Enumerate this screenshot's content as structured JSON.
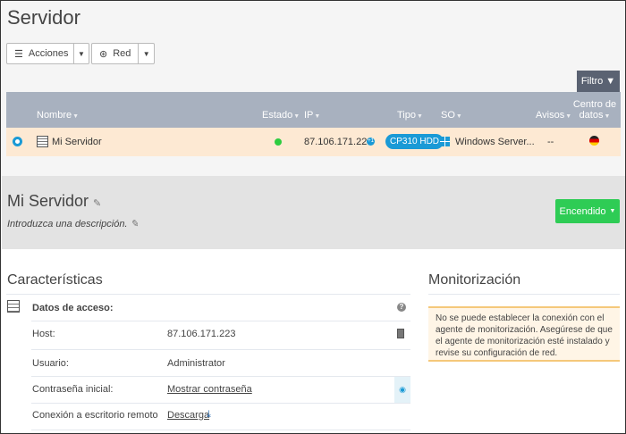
{
  "page_title": "Servidor",
  "toolbar": {
    "actions_label": "Acciones",
    "network_label": "Red",
    "filter_label": "Filtro"
  },
  "table": {
    "headers": {
      "name": "Nombre",
      "status": "Estado",
      "ip": "IP",
      "type": "Tipo",
      "os": "SO",
      "alerts": "Avisos",
      "datacenter": "Centro de datos"
    },
    "rows": [
      {
        "name": "Mi Servidor",
        "status_color": "#2ecc40",
        "ip": "87.106.171.223",
        "ip_extra": "+1",
        "type": "CP310 HDD",
        "os": "Windows Server...",
        "alerts": "--",
        "datacenter_flag": "germany-flag-icon"
      }
    ]
  },
  "detail": {
    "title": "Mi Servidor",
    "description_placeholder": "Introduzca una descripción.",
    "power_button": "Encendido",
    "power_color": "#2ecc55"
  },
  "features": {
    "title": "Características",
    "section": "Datos de acceso:",
    "rows": [
      {
        "label": "Host:",
        "value": "87.106.171.223"
      },
      {
        "label": "Usuario:",
        "value": "Administrator"
      },
      {
        "label": "Contraseña inicial:",
        "value": "Mostrar contraseña"
      },
      {
        "label": "Conexión a escritorio remoto",
        "value": "Descarga"
      }
    ]
  },
  "monitoring": {
    "title": "Monitorización",
    "message": "No se puede establecer la conexión con el agente de monitorización. Asegúrese de que el agente de monitorización esté instalado y revise su configuración de red."
  }
}
